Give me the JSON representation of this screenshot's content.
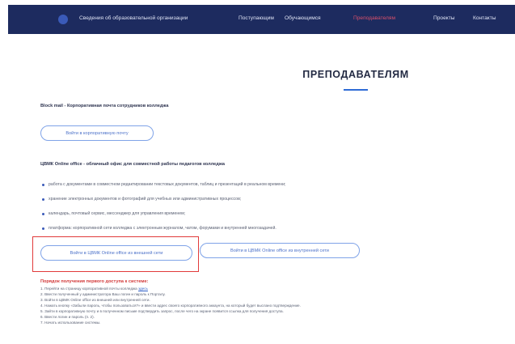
{
  "nav": {
    "items": [
      {
        "label": "Сведения об образовательной организации",
        "active": false
      },
      {
        "label": "Поступающим",
        "active": false
      },
      {
        "label": "Обучающимся",
        "active": false
      },
      {
        "label": "Преподавателям",
        "active": true
      },
      {
        "label": "Проекты",
        "active": false
      },
      {
        "label": "Контакты",
        "active": false
      }
    ]
  },
  "page": {
    "title": "ПРЕПОДАВАТЕЛЯМ"
  },
  "mail": {
    "heading": "Block mail - Корпоративная почта сотрудников колледжа",
    "button": "Войти в корпоративную почту"
  },
  "office": {
    "heading": "ЦВМК Online office - облачный офис для совместной работы педагогов колледжа",
    "bullets": [
      "работа с документами в совместном редактировании текстовых документов, таблиц и презентаций в реальном времени;",
      "хранение электронных документов и фотографий для учебных или административных процессов;",
      "календарь, почтовый сервис, мессенджер для управления временем;",
      "платформа: корпоративной сети колледжа с электронным журналом, чатом, форумами и внутренней многозадачей."
    ],
    "button_internal": "Войти в ЦВМК Online office из внешней сети",
    "button_external": "Войти в ЦВМК Online office из внутренней сети"
  },
  "steps": {
    "heading": "Порядок получения первого доступа к системе:",
    "items": [
      {
        "text": "1. Перейти на страницу корпоративной почты колледжа ",
        "link": "здесь"
      },
      {
        "text": "2. Ввести полученный у администратора Ваш логин и пароль к Порталу.",
        "link": ""
      },
      {
        "text": "3. Войти в ЦВМК Online office из внешней или внутренней сети.",
        "link": ""
      },
      {
        "text": "4. Нажать кнопку «Забыли пароль, чтобы пользоваться?» и ввести адрес своего корпоративного аккаунта, на который будет выслано подтверждение.",
        "link": ""
      },
      {
        "text": "5. Зайти в корпоративную почту и в полученном письме подтвердить запрос, после чего на экране появится ссылка для получения доступа.",
        "link": ""
      },
      {
        "text": "6. Ввести логин и пароль (п. 2).",
        "link": ""
      },
      {
        "text": "7. Начать использование системы.",
        "link": ""
      }
    ]
  },
  "colors": {
    "nav_bg": "#1d2b5f",
    "accent": "#2f6cd6",
    "active_nav": "#d8506b",
    "highlight": "#e13b3b"
  }
}
